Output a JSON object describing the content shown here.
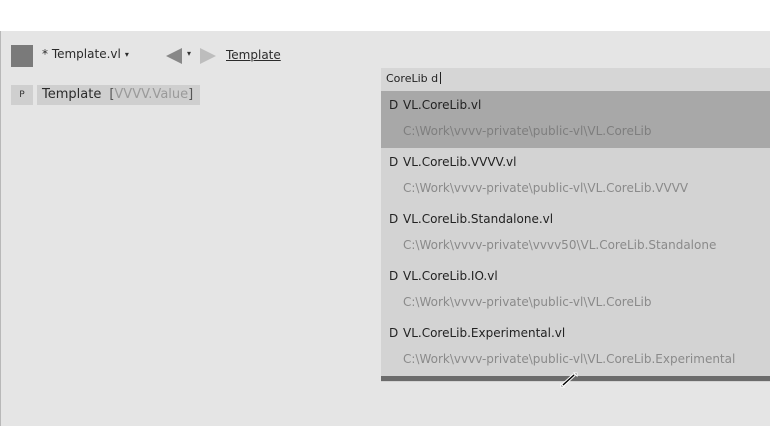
{
  "document": {
    "title": "* Template.vl",
    "title_caret": "▾",
    "breadcrumb": "Template",
    "nav_drop_caret": "▾"
  },
  "pin": {
    "badge": "P",
    "name": "Template",
    "bracket_open": "[",
    "type": "VVVV.Value",
    "bracket_close": "]"
  },
  "search": {
    "query": "CoreLib d"
  },
  "results": [
    {
      "kind": "D",
      "name": "VL.CoreLib.vl",
      "path": "C:\\Work\\vvvv-private\\public-vl\\VL.CoreLib",
      "selected": true
    },
    {
      "kind": "D",
      "name": "VL.CoreLib.VVVV.vl",
      "path": "C:\\Work\\vvvv-private\\public-vl\\VL.CoreLib.VVVV",
      "selected": false
    },
    {
      "kind": "D",
      "name": "VL.CoreLib.Standalone.vl",
      "path": "C:\\Work\\vvvv-private\\vvvv50\\VL.CoreLib.Standalone",
      "selected": false
    },
    {
      "kind": "D",
      "name": "VL.CoreLib.IO.vl",
      "path": "C:\\Work\\vvvv-private\\public-vl\\VL.CoreLib",
      "selected": false
    },
    {
      "kind": "D",
      "name": "VL.CoreLib.Experimental.vl",
      "path": "C:\\Work\\vvvv-private\\public-vl\\VL.CoreLib.Experimental",
      "selected": false
    }
  ],
  "colors": {
    "selected_row": "#a8a8a8",
    "popup_bg": "#d3d3d3",
    "canvas_bg": "#e5e5e5"
  }
}
